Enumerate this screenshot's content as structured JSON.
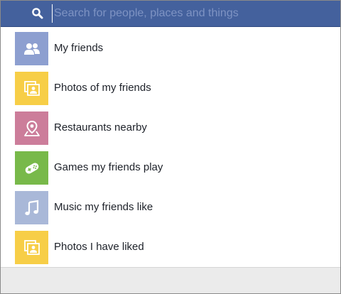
{
  "search": {
    "placeholder": "Search for people, places and things"
  },
  "suggestions": [
    {
      "label": "My friends",
      "icon": "people-icon",
      "color": "#8d9fd0"
    },
    {
      "label": "Photos of my friends",
      "icon": "photos-icon",
      "color": "#f7ce47"
    },
    {
      "label": "Restaurants nearby",
      "icon": "map-pin-icon",
      "color": "#cc7d9a"
    },
    {
      "label": "Games my friends play",
      "icon": "gamepad-icon",
      "color": "#78b94a"
    },
    {
      "label": "Music my friends like",
      "icon": "music-note-icon",
      "color": "#a9b8d8"
    },
    {
      "label": "Photos I have liked",
      "icon": "photos-icon",
      "color": "#f7ce47"
    }
  ],
  "colors": {
    "header": "#44619d",
    "footer": "#ebebeb",
    "text": "#1d2129"
  }
}
